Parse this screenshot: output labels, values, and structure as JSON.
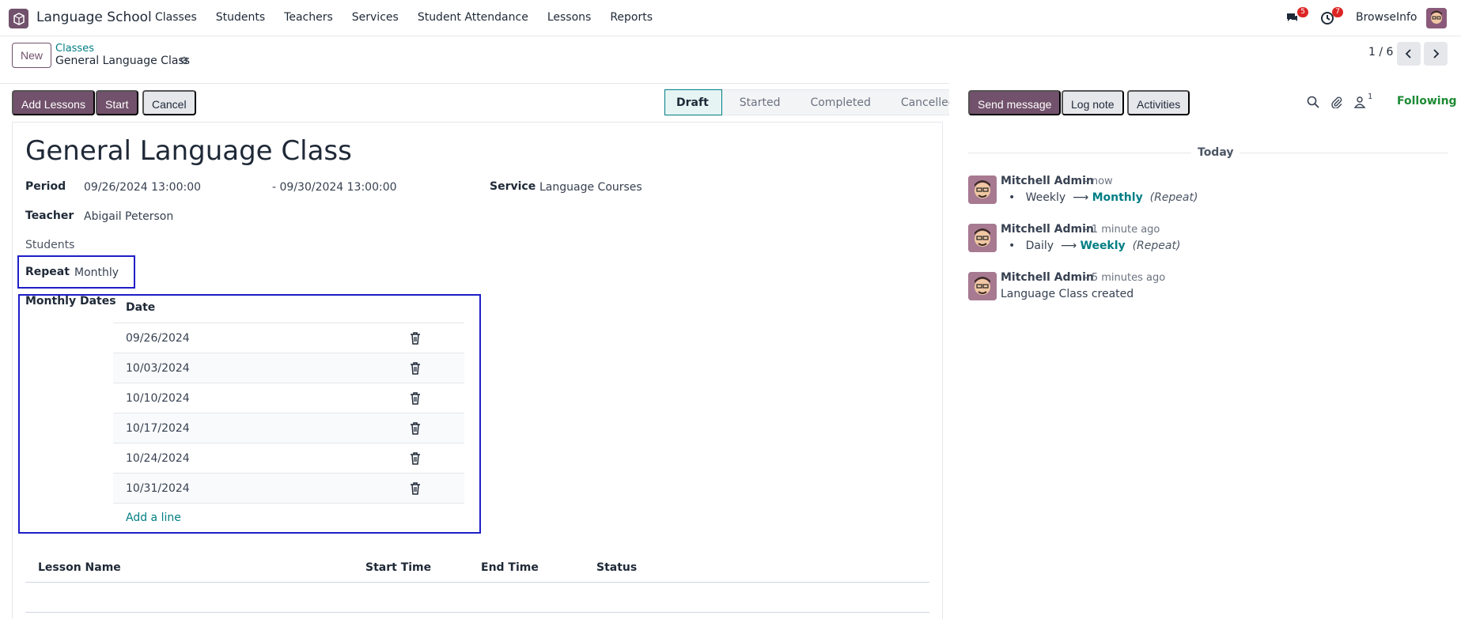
{
  "navbar": {
    "app_name": "Language School",
    "menu": [
      "Classes",
      "Students",
      "Teachers",
      "Services",
      "Student Attendance",
      "Lessons",
      "Reports"
    ],
    "messages_badge": "5",
    "activities_badge": "7",
    "company": "BrowseInfo"
  },
  "control": {
    "new_label": "New",
    "breadcrumb_parent": "Classes",
    "breadcrumb_current": "General Language Class",
    "pager": "1 / 6"
  },
  "actions": {
    "add_lessons": "Add Lessons",
    "start": "Start",
    "cancel": "Cancel"
  },
  "statusbar": {
    "stages": [
      "Draft",
      "Started",
      "Completed",
      "Cancelled"
    ],
    "active": "Draft"
  },
  "form": {
    "title": "General Language Class",
    "period_label": "Period",
    "period_start": "09/26/2024 13:00:00",
    "period_end": "- 09/30/2024 13:00:00",
    "service_label": "Service",
    "service_value": "Language Courses",
    "teacher_label": "Teacher",
    "teacher_value": "Abigail Peterson",
    "students_label": "Students",
    "repeat_label": "Repeat",
    "repeat_value": "Monthly",
    "monthly_dates_label": "Monthly Dates",
    "dates_header": "Date",
    "dates": [
      "09/26/2024",
      "10/03/2024",
      "10/10/2024",
      "10/17/2024",
      "10/24/2024",
      "10/31/2024"
    ],
    "add_line": "Add a line",
    "lessons_columns": [
      "Lesson Name",
      "Start Time",
      "End Time",
      "Status"
    ]
  },
  "chatter": {
    "send_message": "Send message",
    "log_note": "Log note",
    "activities": "Activities",
    "followers_count": "1",
    "following": "Following",
    "today": "Today",
    "messages": [
      {
        "author": "Mitchell Admin",
        "when": "- now",
        "old": "Weekly",
        "new": "Monthly",
        "field": "(Repeat)"
      },
      {
        "author": "Mitchell Admin",
        "when": "- 1 minute ago",
        "old": "Daily",
        "new": "Weekly",
        "field": "(Repeat)"
      },
      {
        "author": "Mitchell Admin",
        "when": "- 5 minutes ago",
        "body": "Language Class created"
      }
    ]
  },
  "colors": {
    "primary": "#71516b",
    "link": "#017e84",
    "highlight": "#1e1ec8",
    "following": "#1e8a34"
  }
}
